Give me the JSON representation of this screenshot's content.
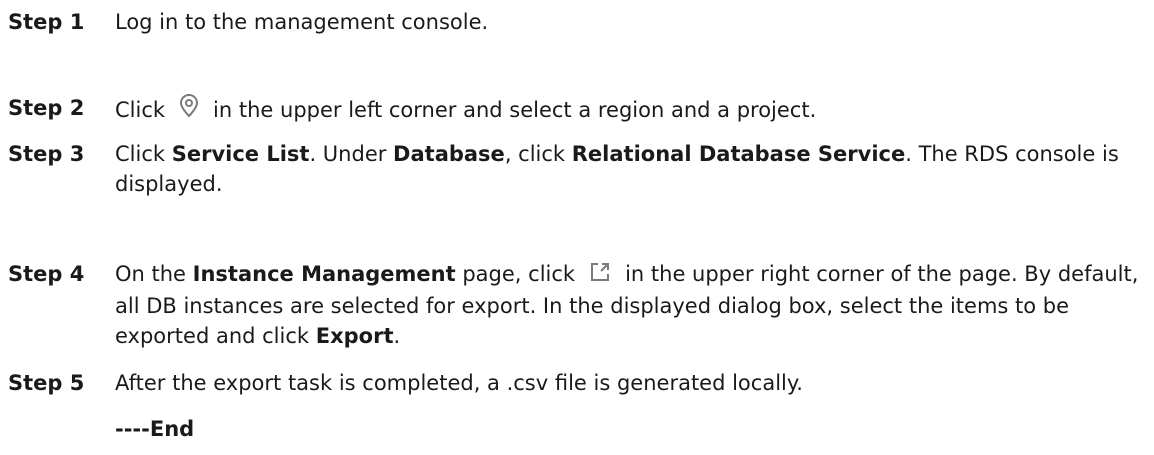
{
  "steps": [
    {
      "label": "Step 1",
      "text": "Log in to the management console."
    },
    {
      "label": "Step 2",
      "before_icon": "Click",
      "icon": "location-pin-icon",
      "after_icon": "in the upper left corner and select a region and a project."
    },
    {
      "label": "Step 3",
      "t1": "Click ",
      "b1": "Service List",
      "t2": ". Under ",
      "b2": "Database",
      "t3": ", click ",
      "b3": "Relational Database Service",
      "t4": ". The RDS console is displayed."
    },
    {
      "label": "Step 4",
      "t1": "On the ",
      "b1": "Instance Management",
      "t2": " page, click",
      "icon": "export-icon",
      "t3": "in the upper right corner of the page. By default, all DB instances are selected for export. In the displayed dialog box, select the items to be exported and click ",
      "b2": "Export",
      "t4": "."
    },
    {
      "label": "Step 5",
      "text": "After the export task is completed, a .csv file is generated locally."
    }
  ],
  "end_marker": "----End",
  "colors": {
    "text": "#1a1a1a",
    "icon_stroke": "#7a7a7a",
    "background": "#ffffff"
  }
}
